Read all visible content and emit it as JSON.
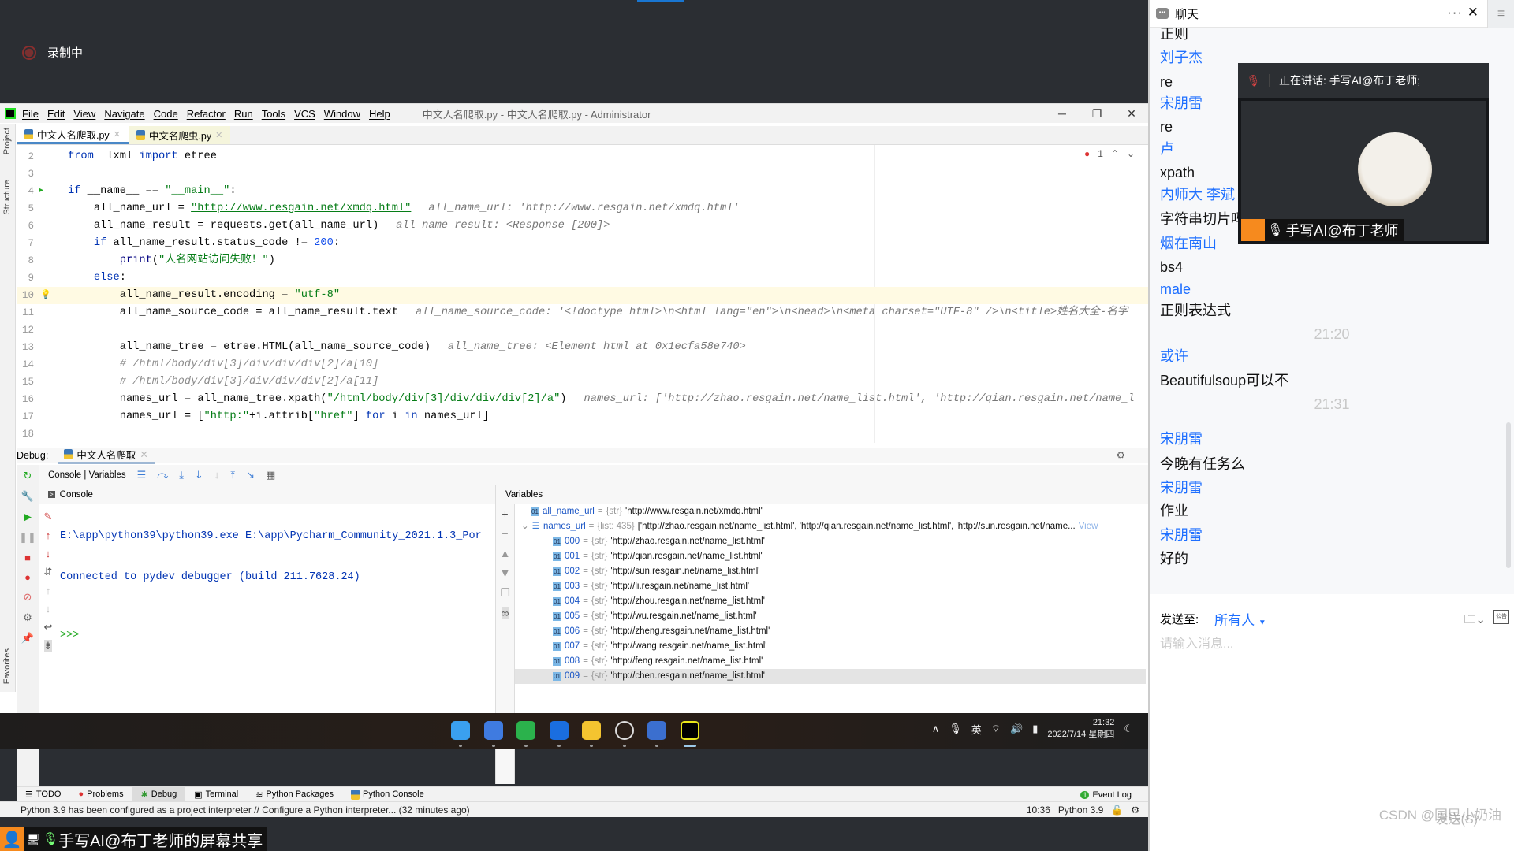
{
  "recording": {
    "label": "录制中"
  },
  "ide": {
    "menu": [
      "File",
      "Edit",
      "View",
      "Navigate",
      "Code",
      "Refactor",
      "Run",
      "Tools",
      "VCS",
      "Window",
      "Help"
    ],
    "title": "中文人名爬取.py - 中文人名爬取.py - Administrator",
    "window_buttons": [
      "─",
      "❐",
      "✕"
    ],
    "side_labels": {
      "project": "Project",
      "structure": "Structure",
      "favorites": "Favorites"
    },
    "tabs": [
      {
        "label": "中文人名爬取.py",
        "active": true
      },
      {
        "label": "中文名爬虫.py",
        "active": false
      }
    ],
    "error_count": "1",
    "editor_lines": [
      {
        "n": "2",
        "indent": 0,
        "tokens": [
          [
            "kw",
            "from"
          ],
          [
            "",
            "  lxml "
          ],
          [
            "kw",
            "import"
          ],
          [
            "",
            " etree"
          ]
        ],
        "hint": ""
      },
      {
        "n": "3",
        "indent": 0,
        "tokens": [],
        "hint": ""
      },
      {
        "n": "4",
        "indent": 0,
        "tokens": [
          [
            "kw",
            "if"
          ],
          [
            "",
            " __name__ == "
          ],
          [
            "str",
            "\"__main__\""
          ],
          [
            "",
            ":"
          ]
        ],
        "hint": "",
        "run": true
      },
      {
        "n": "5",
        "indent": 4,
        "tokens": [
          [
            "",
            "all_name_url = "
          ],
          [
            "url",
            "\"http://www.resgain.net/xmdq.html\""
          ]
        ],
        "hint": "all_name_url: 'http://www.resgain.net/xmdq.html'"
      },
      {
        "n": "6",
        "indent": 4,
        "tokens": [
          [
            "",
            "all_name_result = requests.get(all_name_url)"
          ]
        ],
        "hint": "all_name_result: <Response [200]>"
      },
      {
        "n": "7",
        "indent": 4,
        "tokens": [
          [
            "kw",
            "if"
          ],
          [
            "",
            " all_name_result.status_code != "
          ],
          [
            "num",
            "200"
          ],
          [
            "",
            ":"
          ]
        ],
        "hint": ""
      },
      {
        "n": "8",
        "indent": 8,
        "tokens": [
          [
            "fn",
            "print"
          ],
          [
            "",
            "("
          ],
          [
            "str",
            "\"人名网站访问失败！\""
          ],
          [
            "",
            ")"
          ]
        ],
        "hint": ""
      },
      {
        "n": "9",
        "indent": 4,
        "tokens": [
          [
            "kw",
            "else"
          ],
          [
            "",
            ":"
          ]
        ],
        "hint": ""
      },
      {
        "n": "10",
        "indent": 8,
        "tokens": [
          [
            "",
            "all_name_result.encoding = "
          ],
          [
            "str",
            "\"utf-8\""
          ]
        ],
        "hint": "",
        "current": true
      },
      {
        "n": "11",
        "indent": 8,
        "tokens": [
          [
            "",
            "all_name_source_code = all_name_result.text"
          ]
        ],
        "hint": "all_name_source_code: '<!doctype html>\\n<html lang=\"en\">\\n<head>\\n<meta charset=\"UTF-8\" />\\n<title>姓名大全-名字"
      },
      {
        "n": "12",
        "indent": 0,
        "tokens": [],
        "hint": ""
      },
      {
        "n": "13",
        "indent": 8,
        "tokens": [
          [
            "",
            "all_name_tree = etree.HTML(all_name_source_code)"
          ]
        ],
        "hint": "all_name_tree: <Element html at 0x1ecfa58e740>"
      },
      {
        "n": "14",
        "indent": 8,
        "tokens": [
          [
            "cmt",
            "# /html/body/div[3]/div/div/div[2]/a[10]"
          ]
        ],
        "hint": ""
      },
      {
        "n": "15",
        "indent": 8,
        "tokens": [
          [
            "cmt",
            "# /html/body/div[3]/div/div/div[2]/a[11]"
          ]
        ],
        "hint": ""
      },
      {
        "n": "16",
        "indent": 8,
        "tokens": [
          [
            "",
            "names_url = all_name_tree.xpath("
          ],
          [
            "str",
            "\"/html/body/div[3]/div/div/div[2]/a\""
          ],
          [
            "",
            ")"
          ]
        ],
        "hint": "names_url: ['http://zhao.resgain.net/name_list.html', 'http://qian.resgain.net/name_l"
      },
      {
        "n": "17",
        "indent": 8,
        "tokens": [
          [
            "",
            "names_url = ["
          ],
          [
            "str",
            "\"http:\""
          ],
          [
            "",
            "+i.attrib["
          ],
          [
            "str",
            "\"href\""
          ],
          [
            "",
            "] "
          ],
          [
            "kw",
            "for"
          ],
          [
            "",
            " i "
          ],
          [
            "kw",
            "in"
          ],
          [
            "",
            " names_url]"
          ]
        ],
        "hint": ""
      },
      {
        "n": "18",
        "indent": 0,
        "tokens": [],
        "hint": ""
      }
    ],
    "debug": {
      "label": "Debug:",
      "session": "中文人名爬取",
      "toolbar_label": "Console | Variables",
      "console_header": "Console",
      "console_lines": [
        "E:\\app\\python39\\python39.exe E:\\app\\Pycharm_Community_2021.1.3_Por",
        "Connected to pydev debugger (build 211.7628.24)"
      ],
      "prompt": ">>>",
      "variables_header": "Variables",
      "variables": [
        {
          "name": "all_name_url",
          "type": "{str}",
          "value": "'http://www.resgain.net/xmdq.html'",
          "level": 0
        },
        {
          "name": "names_url",
          "type": "{list: 435}",
          "value": "['http://zhao.resgain.net/name_list.html', 'http://qian.resgain.net/name_list.html', 'http://sun.resgain.net/name...",
          "view": "View",
          "level": 0,
          "expanded": true
        },
        {
          "name": "000",
          "type": "{str}",
          "value": "'http://zhao.resgain.net/name_list.html'",
          "level": 1
        },
        {
          "name": "001",
          "type": "{str}",
          "value": "'http://qian.resgain.net/name_list.html'",
          "level": 1
        },
        {
          "name": "002",
          "type": "{str}",
          "value": "'http://sun.resgain.net/name_list.html'",
          "level": 1
        },
        {
          "name": "003",
          "type": "{str}",
          "value": "'http://li.resgain.net/name_list.html'",
          "level": 1
        },
        {
          "name": "004",
          "type": "{str}",
          "value": "'http://zhou.resgain.net/name_list.html'",
          "level": 1
        },
        {
          "name": "005",
          "type": "{str}",
          "value": "'http://wu.resgain.net/name_list.html'",
          "level": 1
        },
        {
          "name": "006",
          "type": "{str}",
          "value": "'http://zheng.resgain.net/name_list.html'",
          "level": 1
        },
        {
          "name": "007",
          "type": "{str}",
          "value": "'http://wang.resgain.net/name_list.html'",
          "level": 1
        },
        {
          "name": "008",
          "type": "{str}",
          "value": "'http://feng.resgain.net/name_list.html'",
          "level": 1
        },
        {
          "name": "009",
          "type": "{str}",
          "value": "'http://chen.resgain.net/name_list.html'",
          "level": 1
        }
      ]
    },
    "bottom_tabs": [
      "TODO",
      "Problems",
      "Debug",
      "Terminal",
      "Python Packages",
      "Python Console"
    ],
    "event_log": {
      "count": "1",
      "label": "Event Log"
    },
    "status": {
      "message": "Python 3.9 has been configured as a project interpreter // Configure a Python interpreter... (32 minutes ago)",
      "position": "10:36",
      "interpreter": "Python 3.9"
    }
  },
  "taskbar": {
    "apps": [
      "windows-start",
      "chrome",
      "wechat",
      "tencent-meeting",
      "file-explorer",
      "obs",
      "remote-desktop",
      "pycharm"
    ],
    "tray": {
      "ime": "英",
      "time": "21:32",
      "date": "2022/7/14 星期四"
    }
  },
  "share_bar": {
    "label": "手写AI@布丁老师的屏幕共享"
  },
  "chat": {
    "title": "聊天",
    "messages": [
      {
        "kind": "text",
        "text": "正则"
      },
      {
        "kind": "sender",
        "text": "刘子杰"
      },
      {
        "kind": "text",
        "text": "re"
      },
      {
        "kind": "sender",
        "text": "宋朋雷"
      },
      {
        "kind": "text",
        "text": "re"
      },
      {
        "kind": "sender",
        "text": "卢"
      },
      {
        "kind": "text",
        "text": "xpath"
      },
      {
        "kind": "sender",
        "text": "内师大 李斌"
      },
      {
        "kind": "text",
        "text": "字符串切片吗"
      },
      {
        "kind": "sender",
        "text": "烟在南山"
      },
      {
        "kind": "text",
        "text": "bs4"
      },
      {
        "kind": "sender",
        "text": "male"
      },
      {
        "kind": "text",
        "text": "正则表达式"
      },
      {
        "kind": "time",
        "text": "21:20"
      },
      {
        "kind": "sender",
        "text": "或许"
      },
      {
        "kind": "text",
        "text": "Beautifulsoup可以不"
      },
      {
        "kind": "time",
        "text": "21:31"
      },
      {
        "kind": "sender",
        "text": "宋朋雷"
      },
      {
        "kind": "text",
        "text": "今晚有任务么"
      },
      {
        "kind": "sender",
        "text": "宋朋雷"
      },
      {
        "kind": "text",
        "text": "作业"
      },
      {
        "kind": "sender",
        "text": "宋朋雷"
      },
      {
        "kind": "text",
        "text": "好的"
      }
    ],
    "send_to_label": "发送至:",
    "send_to_value": "所有人",
    "notice_icon_text": "公告",
    "input_placeholder": "请输入消息...",
    "watermark": "CSDN @国民小奶油",
    "send_button": "发送(S)"
  },
  "video": {
    "speaking": "正在讲话: 手写AI@布丁老师;",
    "name": "手写AI@布丁老师"
  }
}
